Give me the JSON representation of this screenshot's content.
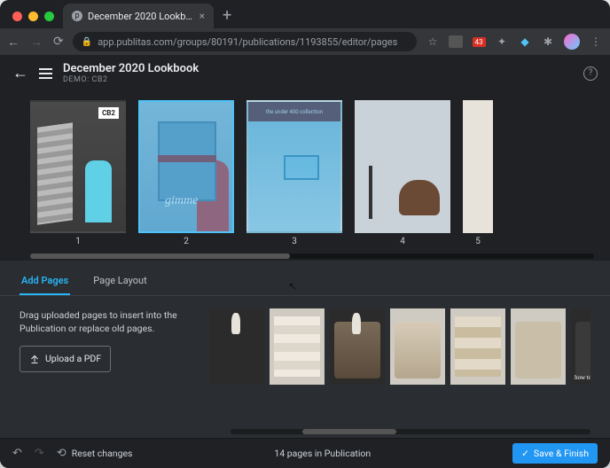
{
  "browser": {
    "tab_title": "December 2020 Lookbook",
    "url": "app.publitas.com/groups/80191/publications/1193855/editor/pages",
    "ext_badge": "43"
  },
  "header": {
    "title": "December 2020 Lookbook",
    "subtitle": "DEMO: CB2"
  },
  "pages": {
    "items": [
      {
        "num": "1",
        "logo": "CB2"
      },
      {
        "num": "2",
        "gimme": "gimme"
      },
      {
        "num": "3",
        "bar": "the under 400 collection"
      },
      {
        "num": "4"
      },
      {
        "num": "5"
      }
    ]
  },
  "panel": {
    "tabs": {
      "add": "Add Pages",
      "layout": "Page Layout"
    },
    "hint": "Drag uploaded pages to insert into the Publication or replace old pages.",
    "upload": "Upload a PDF"
  },
  "footer": {
    "reset": "Reset changes",
    "status": "14 pages in Publication",
    "save": "Save & Finish"
  }
}
